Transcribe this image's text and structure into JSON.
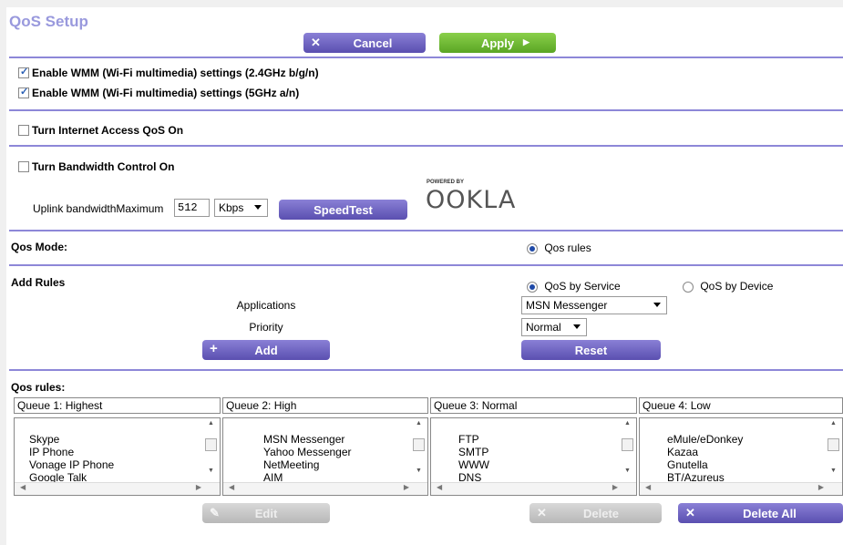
{
  "page_title": "QoS Setup",
  "buttons": {
    "cancel": "Cancel",
    "apply": "Apply",
    "speedtest": "SpeedTest",
    "add": "Add",
    "reset": "Reset",
    "edit": "Edit",
    "delete": "Delete",
    "delete_all": "Delete All"
  },
  "wmm": {
    "wmm_24": {
      "label": "Enable WMM (Wi-Fi multimedia) settings (2.4GHz b/g/n)",
      "checked": true
    },
    "wmm_5": {
      "label": "Enable WMM (Wi-Fi multimedia) settings (5GHz a/n)",
      "checked": true
    }
  },
  "internet_qos": {
    "label": "Turn Internet Access QoS On",
    "checked": false
  },
  "bandwidth": {
    "label": "Turn Bandwidth Control On",
    "checked": false,
    "uplink_label": "Uplink bandwidthMaximum",
    "uplink_value": "512",
    "unit": "Kbps",
    "powered_by": "POWERED BY",
    "brand": "OOKLA"
  },
  "qos_mode": {
    "label": "Qos Mode:",
    "option": "Qos rules",
    "selected": true
  },
  "add_rules": {
    "label": "Add Rules",
    "by_service": "QoS by Service",
    "by_device": "QoS by Device",
    "by_service_selected": true,
    "applications_label": "Applications",
    "applications_value": "MSN Messenger",
    "priority_label": "Priority",
    "priority_value": "Normal"
  },
  "qos_rules": {
    "label": "Qos rules:",
    "queues": [
      {
        "title": "Queue 1: Highest",
        "items": [
          "Skype",
          "IP Phone",
          "Vonage IP Phone",
          "Google Talk"
        ]
      },
      {
        "title": "Queue 2: High",
        "items": [
          "MSN Messenger",
          "Yahoo Messenger",
          "NetMeeting",
          "AIM"
        ]
      },
      {
        "title": "Queue 3: Normal",
        "items": [
          "FTP",
          "SMTP",
          "WWW",
          "DNS"
        ]
      },
      {
        "title": "Queue 4: Low",
        "items": [
          "eMule/eDonkey",
          "Kazaa",
          "Gnutella",
          "BT/Azureus"
        ]
      }
    ]
  },
  "colors": {
    "accent": "#8d87d8",
    "title": "#9999dd",
    "apply": "#6ab82e",
    "button": "#5a4fb0"
  }
}
